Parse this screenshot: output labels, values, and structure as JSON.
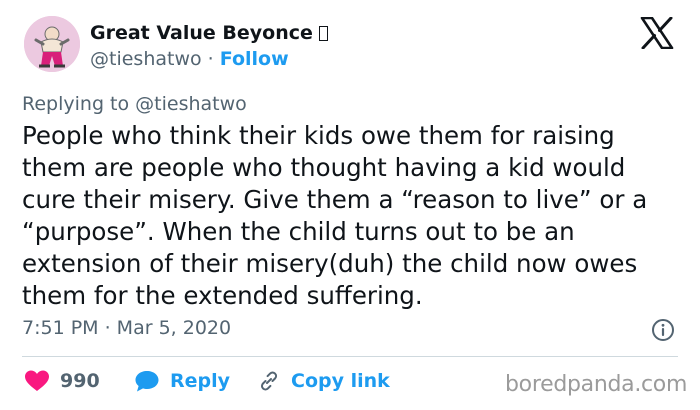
{
  "author": {
    "name": "Great Value Beyonce",
    "handle": "@tieshatwo",
    "separator": "·",
    "follow_label": "Follow"
  },
  "icons": {
    "platform": "x-logo-icon",
    "info": "info-icon",
    "like": "heart-icon",
    "reply": "reply-bubble-icon",
    "copy_link": "link-icon"
  },
  "tweet": {
    "replying_to": "Replying to @tieshatwo",
    "text": "People who think their kids owe them for raising\nthem are people who thought having a kid would\ncure their misery. Give them a “reason to live” or a\n“purpose”. When the child turns out to be an\nextension of their misery(duh) the child now owes\nthem for the extended suffering.",
    "timestamp": "7:51 PM · Mar 5, 2020"
  },
  "actions": {
    "like_count": "990",
    "reply_label": "Reply",
    "copy_link_label": "Copy link"
  },
  "watermark": "boredpanda.com",
  "colors": {
    "like": "#f91880",
    "accent": "#1d9bf0",
    "secondary_text": "#536471",
    "primary_text": "#0f1419"
  }
}
